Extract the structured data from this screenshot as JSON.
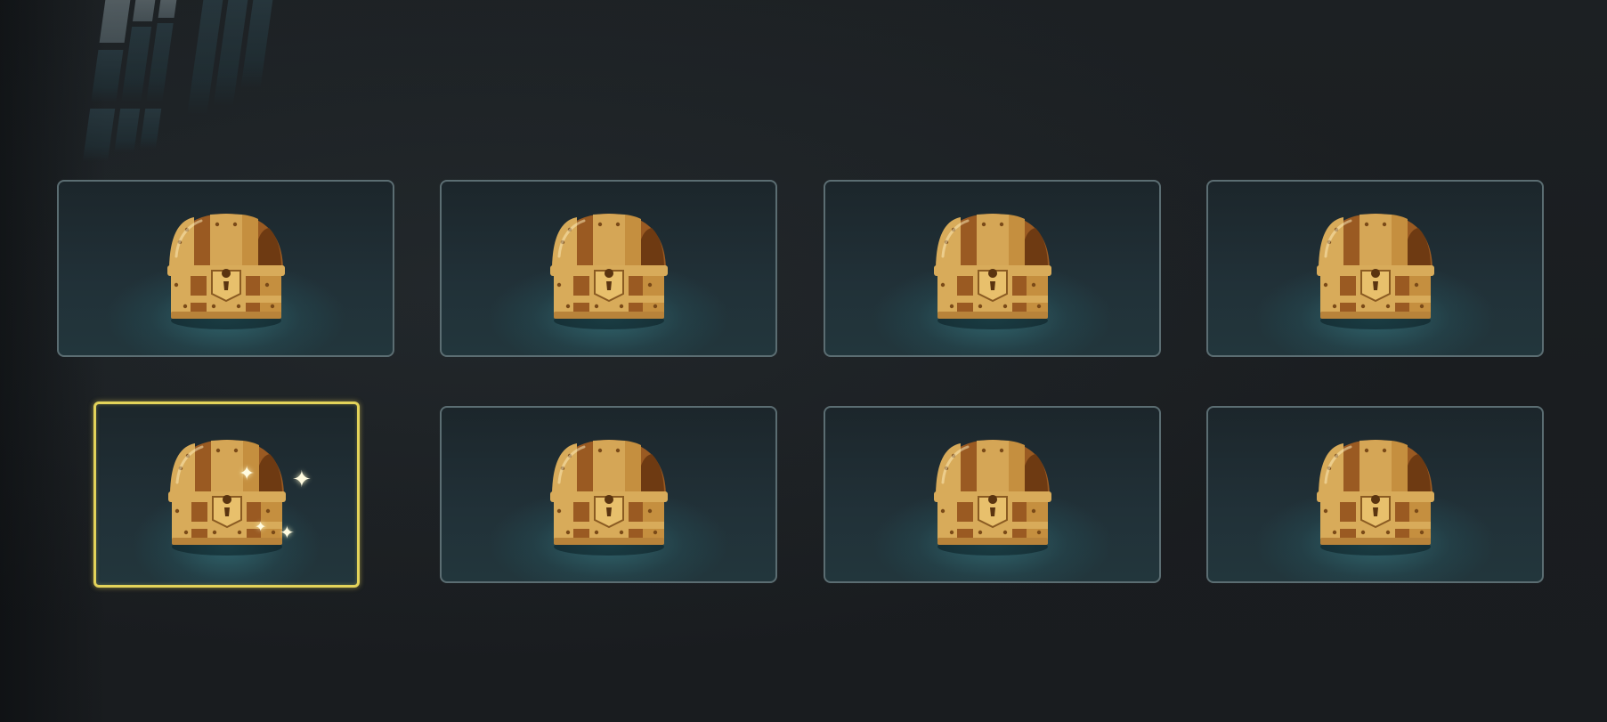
{
  "scene": {
    "name": "treasure-chest-selection",
    "background_color": "#1b1e21"
  },
  "colors": {
    "slot_border": "#5b6d72",
    "selected_border": "#e3d35a",
    "chest_gold": "#d8ab5a",
    "chest_wood": "#9a5a22"
  },
  "slots": [
    {
      "id": 1,
      "item": "chest-icon",
      "selected": false
    },
    {
      "id": 2,
      "item": "chest-icon",
      "selected": false
    },
    {
      "id": 3,
      "item": "chest-icon",
      "selected": false
    },
    {
      "id": 4,
      "item": "chest-icon",
      "selected": false
    },
    {
      "id": 5,
      "item": "chest-icon",
      "selected": true,
      "sparkle": true
    },
    {
      "id": 6,
      "item": "chest-icon",
      "selected": false
    },
    {
      "id": 7,
      "item": "chest-icon",
      "selected": false
    },
    {
      "id": 8,
      "item": "chest-icon",
      "selected": false
    }
  ]
}
